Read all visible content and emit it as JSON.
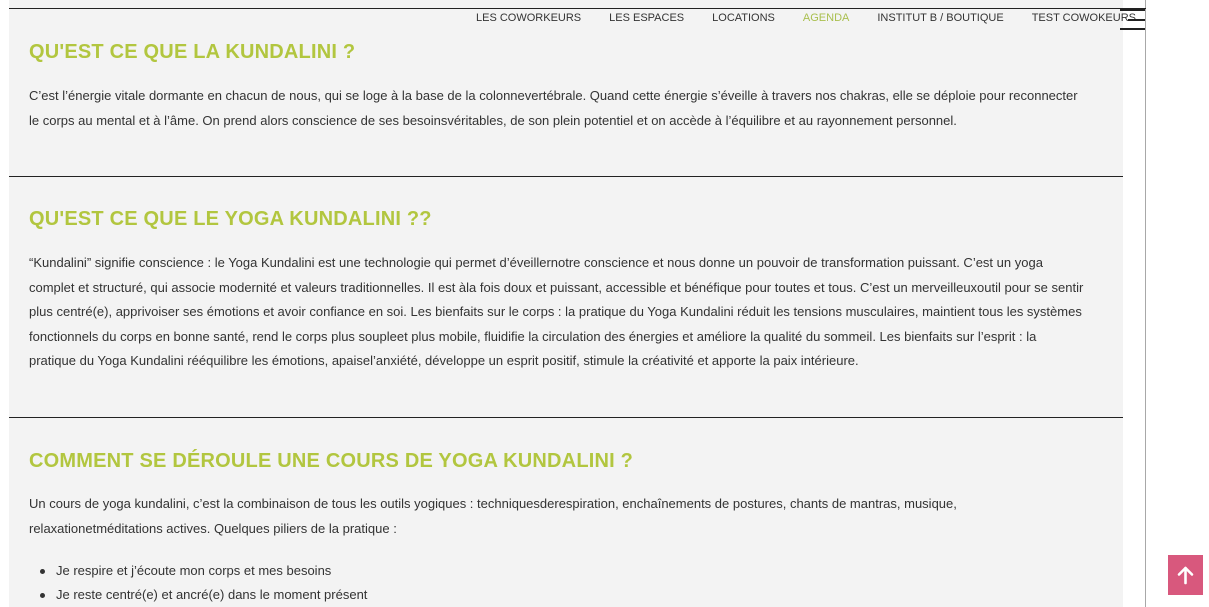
{
  "nav": {
    "items": [
      {
        "label": "LES COWORKEURS"
      },
      {
        "label": "LES ESPACES"
      },
      {
        "label": "LOCATIONS"
      },
      {
        "label": "AGENDA"
      },
      {
        "label": "INSTITUT B / BOUTIQUE"
      },
      {
        "label": "TEST COWOKEURS"
      }
    ],
    "active_index": 3,
    "active_color": "#a9bf4e",
    "menu_icon": "hamburger-icon"
  },
  "sections": [
    {
      "title": "QU'EST CE QUE LA KUNDALINI ?",
      "body": "C’est l’énergie vitale dormante en chacun de nous, qui se loge à la base de la colonnevertébrale. Quand cette énergie s’éveille à travers nos chakras, elle se déploie pour reconnecter le corps au mental et à l’âme. On prend alors conscience de ses besoinsvéritables, de son plein potentiel et on accède à l’équilibre et au rayonnement personnel."
    },
    {
      "title": "QU'EST CE QUE LE YOGA KUNDALINI ??",
      "body": "“Kundalini” signifie conscience : le Yoga Kundalini est une technologie qui permet d’éveillernotre conscience et nous donne un pouvoir de transformation puissant. C’est un yoga complet et structuré, qui associe modernité et valeurs traditionnelles. Il est àla fois doux et puissant, accessible et bénéfique pour toutes et tous. C’est un merveilleuxoutil pour se sentir plus centré(e), apprivoiser ses émotions et avoir confiance en soi. Les bienfaits sur le corps : la pratique du Yoga Kundalini réduit les tensions musculaires, maintient tous les systèmes fonctionnels du corps en bonne santé, rend le corps plus soupleet plus mobile, fluidifie la circulation des énergies et améliore la qualité du sommeil. Les bienfaits sur l’esprit : la pratique du Yoga Kundalini rééquilibre les émotions, apaisel’anxiété, développe un esprit positif, stimule la créativité et apporte la paix intérieure."
    },
    {
      "title": "COMMENT SE DÉROULE UNE COURS DE YOGA KUNDALINI ?",
      "body": "Un cours de yoga kundalini, c’est la combinaison de tous les outils yogiques : techniquesderespiration, enchaînements de postures, chants de mantras, musique, relaxationetméditations actives. Quelques piliers de la pratique :",
      "list": [
        "Je respire et j’écoute mon corps et mes besoins",
        "Je reste centré(e) et ancré(e) dans le moment présent"
      ]
    }
  ],
  "colors": {
    "heading": "#b2c63f",
    "scroll_button": "#d8587d"
  },
  "scroll_top_icon": "arrow-up-icon"
}
